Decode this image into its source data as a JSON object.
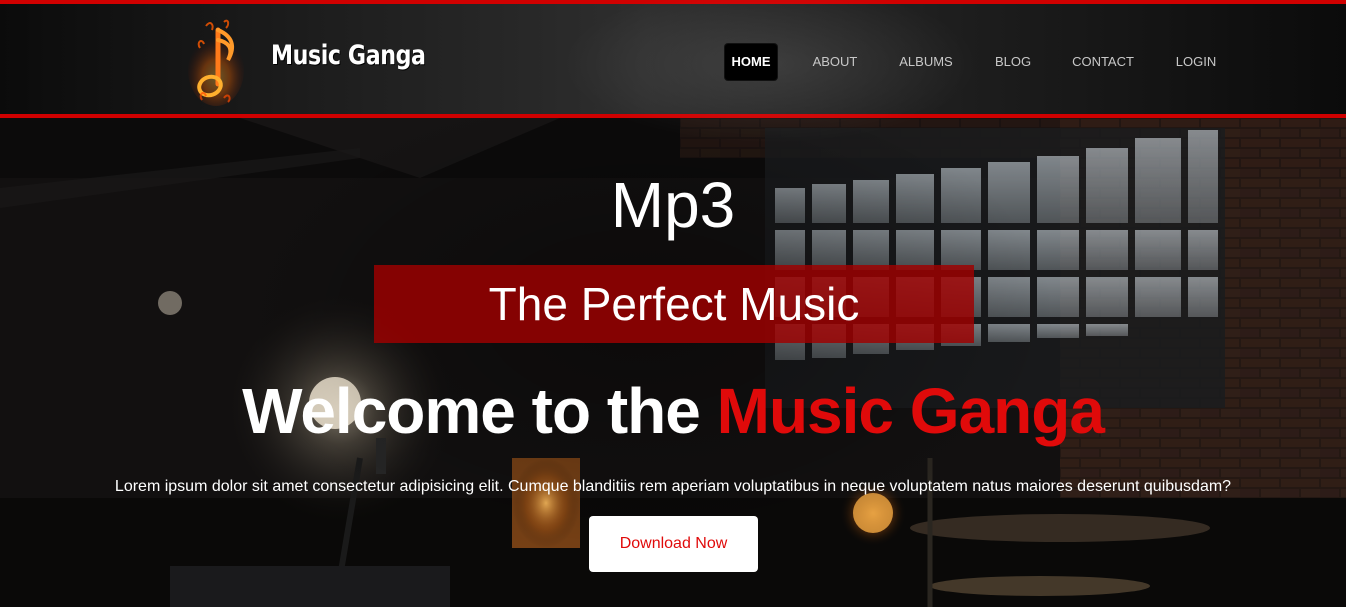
{
  "brand": {
    "name": "Music Ganga",
    "logo_icon": "music-note-fire-icon"
  },
  "nav": {
    "items": [
      {
        "label": "HOME",
        "active": true
      },
      {
        "label": "ABOUT",
        "active": false
      },
      {
        "label": "ALBUMS",
        "active": false
      },
      {
        "label": "BLOG",
        "active": false
      },
      {
        "label": "CONTACT",
        "active": false
      },
      {
        "label": "LOGIN",
        "active": false
      }
    ]
  },
  "hero": {
    "title": "Mp3",
    "banner": "The Perfect Music",
    "welcome_prefix": "Welcome to the ",
    "welcome_accent": "Music Ganga",
    "description": "Lorem ipsum dolor sit amet consectetur adipisicing elit. Cumque blanditiis rem aperiam voluptatibus in neque voluptatem natus maiores deserunt quibusdam?",
    "button_label": "Download Now"
  },
  "colors": {
    "accent": "#e00a0a",
    "border_red": "#d00000",
    "banner_red": "#a00000",
    "header_dark": "#1c1c1c"
  }
}
